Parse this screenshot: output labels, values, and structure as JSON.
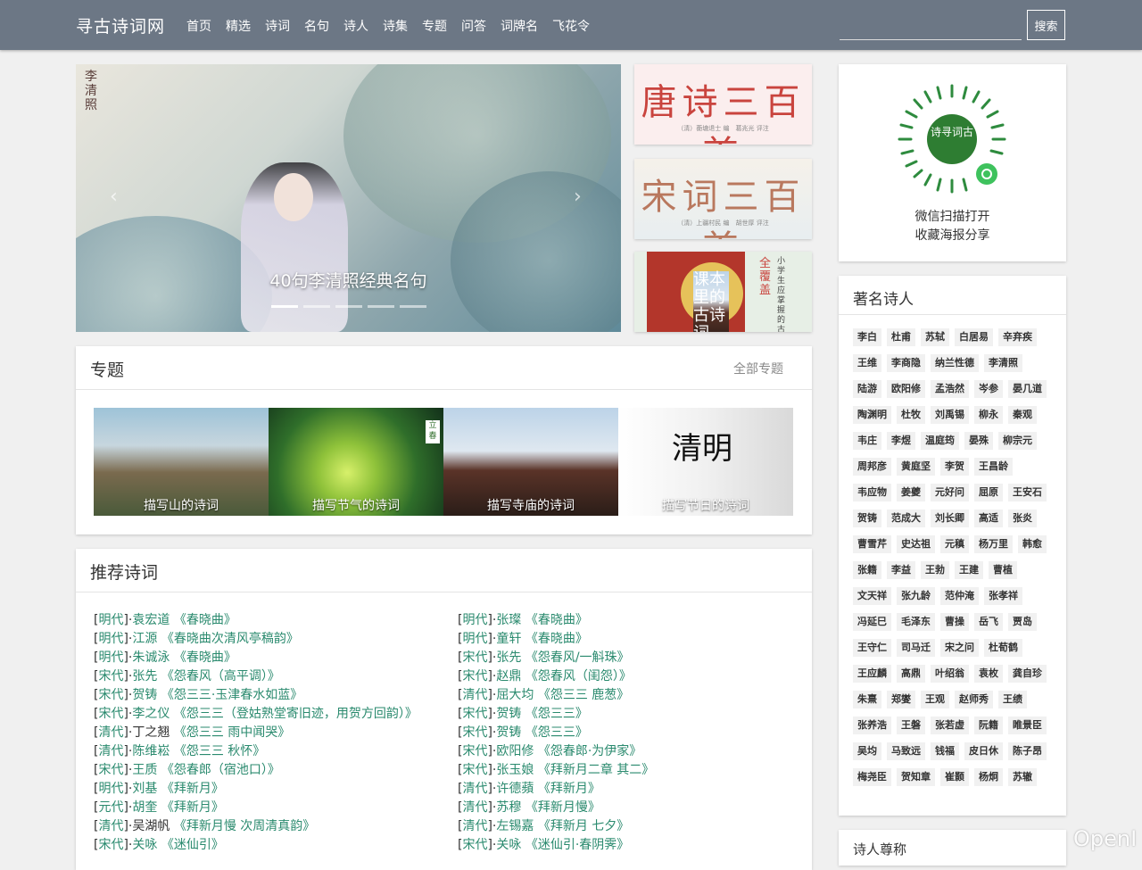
{
  "header": {
    "brand": "寻古诗词网",
    "nav": [
      "首页",
      "精选",
      "诗词",
      "名句",
      "诗人",
      "诗集",
      "专题",
      "问答",
      "词牌名",
      "飞花令"
    ],
    "search_placeholder": "",
    "search_label": "搜索"
  },
  "carousel": {
    "caption": "40句李清照经典名句",
    "calligraphy": "李清照",
    "slides": 5,
    "active_slide": 1
  },
  "books": {
    "tang": {
      "title": "唐诗三百首",
      "sub": "（清）蘅塘退士 编　葛兆光 评注"
    },
    "song": {
      "title": "宋词三百首",
      "sub": "（清）上疆村民 编　胡世厚 评注"
    },
    "kids": {
      "title": "课本里的古诗词",
      "vertical": "全覆盖",
      "vertical2": "小学生应掌握的古诗词"
    }
  },
  "qr": {
    "line1": "微信扫描打开",
    "line2": "收藏海报分享",
    "logo_text": "诗寻词古"
  },
  "poets": {
    "title": "著名诗人",
    "rows": [
      [
        "李白",
        "杜甫",
        "苏轼",
        "白居易",
        "辛弃疾"
      ],
      [
        "王维",
        "李商隐",
        "纳兰性德",
        "李清照"
      ],
      [
        "陆游",
        "欧阳修",
        "孟浩然",
        "岑参",
        "晏几道"
      ],
      [
        "陶渊明",
        "杜牧",
        "刘禹锡",
        "柳永",
        "秦观"
      ],
      [
        "韦庄",
        "李煜",
        "温庭筠",
        "晏殊",
        "柳宗元"
      ],
      [
        "周邦彦",
        "黄庭坚",
        "李贺",
        "王昌龄"
      ],
      [
        "韦应物",
        "姜夔",
        "元好问",
        "屈原",
        "王安石"
      ],
      [
        "贺铸",
        "范成大",
        "刘长卿",
        "高适",
        "张炎"
      ],
      [
        "曹雪芹",
        "史达祖",
        "元稹",
        "杨万里",
        "韩愈"
      ],
      [
        "张籍",
        "李益",
        "王勃",
        "王建",
        "曹植"
      ],
      [
        "文天祥",
        "张九龄",
        "范仲淹",
        "张孝祥"
      ],
      [
        "冯延巳",
        "毛泽东",
        "曹操",
        "岳飞",
        "贾岛"
      ],
      [
        "王守仁",
        "司马迁",
        "宋之问",
        "杜荀鹤"
      ],
      [
        "王应麟",
        "高鼎",
        "叶绍翁",
        "袁枚",
        "龚自珍"
      ],
      [
        "朱熹",
        "郑燮",
        "王观",
        "赵师秀",
        "王绩"
      ],
      [
        "张养浩",
        "王磐",
        "张若虚",
        "阮籍",
        "睢景臣"
      ],
      [
        "吴均",
        "马致远",
        "钱福",
        "皮日休",
        "陈子昂"
      ],
      [
        "梅尧臣",
        "贺知章",
        "崔颢",
        "杨炯",
        "苏辙"
      ]
    ]
  },
  "titles_card": {
    "title": "诗人尊称"
  },
  "topics": {
    "title": "专题",
    "more": "全部专题",
    "items": [
      "描写山的诗词",
      "描写节气的诗词",
      "描写寺庙的诗词",
      "描写节日的诗词"
    ],
    "tile2_badge": "立春",
    "tile4_big": "清明"
  },
  "recommend": {
    "title": "推荐诗词",
    "left": [
      {
        "dyn": "明代",
        "author": "袁宏道",
        "title": "《春晓曲》"
      },
      {
        "dyn": "明代",
        "author": "江源",
        "title": "《春晓曲次清风亭稿韵》"
      },
      {
        "dyn": "明代",
        "author": "朱诚泳",
        "title": "《春晓曲》"
      },
      {
        "dyn": "宋代",
        "author": "张先",
        "title": "《怨春风（高平调）》"
      },
      {
        "dyn": "宋代",
        "author": "贺铸",
        "title": "《怨三三·玉津春水如蓝》"
      },
      {
        "dyn": "宋代",
        "author": "李之仪",
        "title": "《怨三三（登姑熟堂寄旧迹，用贺方回韵）》"
      },
      {
        "dyn": "清代",
        "author": "丁之翘",
        "title": "《怨三三 雨中闻哭》",
        "plain": true
      },
      {
        "dyn": "清代",
        "author": "陈维崧",
        "title": "《怨三三 秋怀》"
      },
      {
        "dyn": "宋代",
        "author": "王质",
        "title": "《怨春郎（宿池口）》"
      },
      {
        "dyn": "明代",
        "author": "刘基",
        "title": "《拜新月》"
      },
      {
        "dyn": "元代",
        "author": "胡奎",
        "title": "《拜新月》"
      },
      {
        "dyn": "清代",
        "author": "吴湖帆",
        "title": "《拜新月慢 次周清真韵》",
        "plain": true
      },
      {
        "dyn": "宋代",
        "author": "关咏",
        "title": "《迷仙引》"
      }
    ],
    "right": [
      {
        "dyn": "明代",
        "author": "张璨",
        "title": "《春晓曲》"
      },
      {
        "dyn": "明代",
        "author": "童轩",
        "title": "《春晓曲》"
      },
      {
        "dyn": "宋代",
        "author": "张先",
        "title": "《怨春风/一斛珠》"
      },
      {
        "dyn": "宋代",
        "author": "赵鼎",
        "title": "《怨春风（闺怨）》"
      },
      {
        "dyn": "清代",
        "author": "屈大均",
        "title": "《怨三三 鹿葱》"
      },
      {
        "dyn": "宋代",
        "author": "贺铸",
        "title": "《怨三三》"
      },
      {
        "dyn": "宋代",
        "author": "贺铸",
        "title": "《怨三三》"
      },
      {
        "dyn": "宋代",
        "author": "欧阳修",
        "title": "《怨春郎·为伊家》"
      },
      {
        "dyn": "宋代",
        "author": "张玉娘",
        "title": "《拜新月二章 其二》"
      },
      {
        "dyn": "清代",
        "author": "许德蘋",
        "title": "《拜新月》"
      },
      {
        "dyn": "清代",
        "author": "苏穆",
        "title": "《拜新月慢》"
      },
      {
        "dyn": "清代",
        "author": "左锡嘉",
        "title": "《拜新月 七夕》"
      },
      {
        "dyn": "宋代",
        "author": "关咏",
        "title": "《迷仙引·春阴霁》"
      }
    ]
  },
  "watermark": "OpenI",
  "colors": {
    "topbar": "#6c7785",
    "link": "#2a8a6e",
    "background": "#f0f0f0"
  }
}
